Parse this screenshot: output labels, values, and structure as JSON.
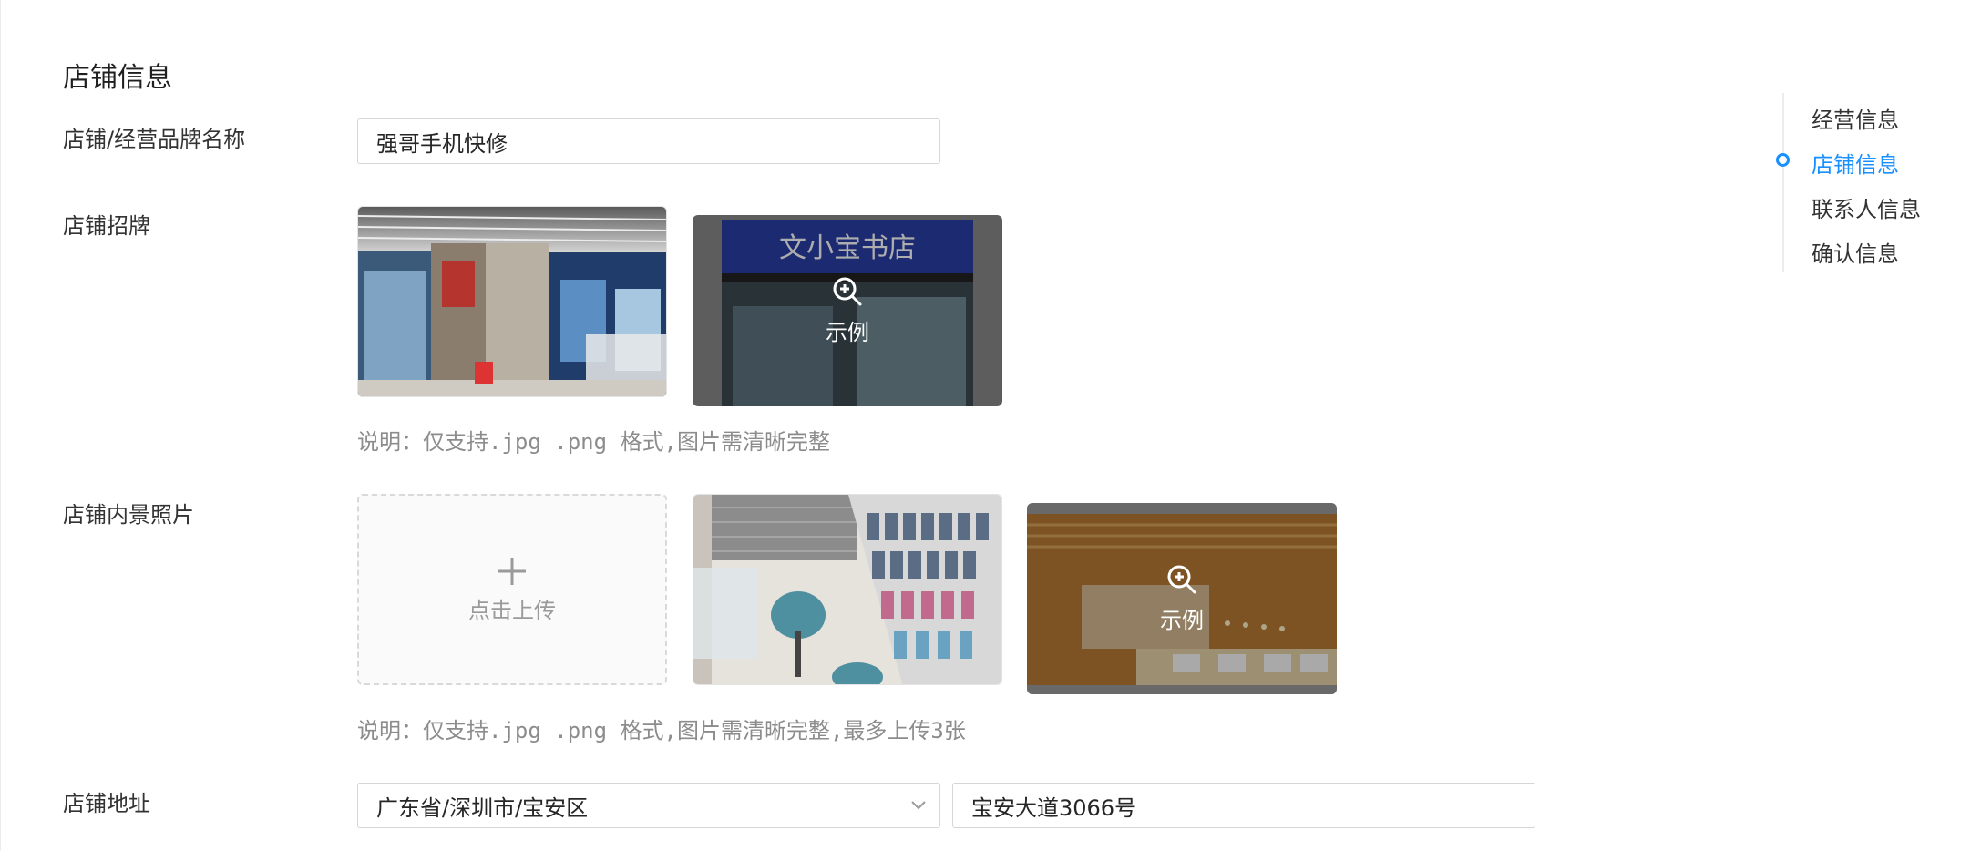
{
  "section_title": "店铺信息",
  "fields": {
    "brand_name": {
      "label": "店铺/经营品牌名称",
      "value": "强哥手机快修"
    },
    "signboard": {
      "label": "店铺招牌",
      "sample_label": "示例",
      "note": "说明：仅支持.jpg .png 格式,图片需清晰完整"
    },
    "interior": {
      "label": "店铺内景照片",
      "upload_label": "点击上传",
      "sample_label": "示例",
      "note": "说明：仅支持.jpg .png 格式,图片需清晰完整,最多上传3张"
    },
    "address": {
      "label": "店铺地址",
      "region": "广东省/深圳市/宝安区",
      "street": "宝安大道3066号"
    }
  },
  "signboard_sample_sign_text": "文小宝书店",
  "anchor_nav": {
    "items": [
      "经营信息",
      "店铺信息",
      "联系人信息",
      "确认信息"
    ],
    "active_index": 1
  },
  "colors": {
    "accent": "#1890ff",
    "border": "#d6d6d6",
    "note": "#8c8c8c"
  },
  "icons": {
    "zoom": "zoom-in-icon",
    "upload": "plus-icon",
    "select": "chevron-down-icon"
  }
}
